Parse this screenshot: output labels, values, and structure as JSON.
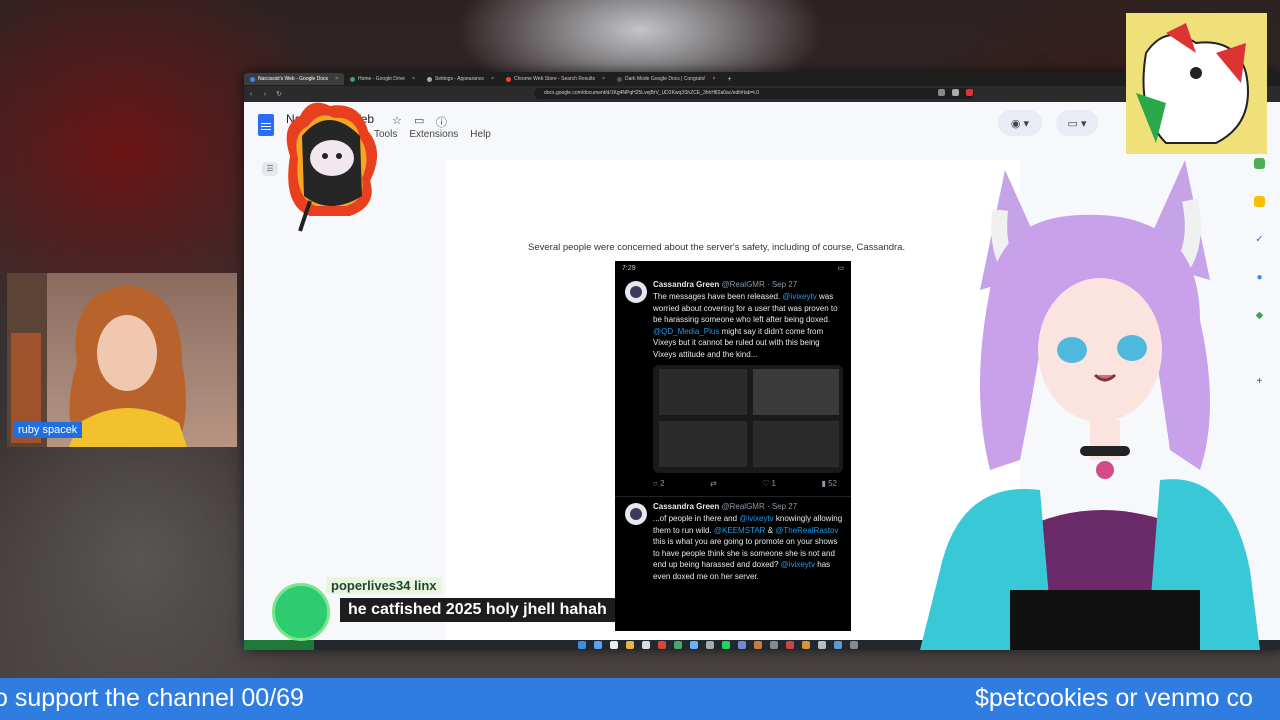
{
  "browser": {
    "tabs": [
      {
        "label": "Narcissist's Web - Google Docs",
        "active": true
      },
      {
        "label": "Home - Google Drive",
        "active": false
      },
      {
        "label": "Settings - Appearance",
        "active": false
      },
      {
        "label": "Chrome Web Store - Search Results",
        "active": false
      },
      {
        "label": "Dark Mode Google Docs | Congrats!",
        "active": false
      }
    ],
    "new_tab": "+",
    "url": "docs.google.com/document/d/1Kg4NPqH25LvejBrV_UD2Kwq3ShZCE_3hhH82a0ac/edit#tab=t.0"
  },
  "docs": {
    "title": "Narcissist's Web",
    "menu": [
      "Tools",
      "Extensions",
      "Help"
    ],
    "body_text": "Several people were concerned about the server's safety, including of course, Cassandra."
  },
  "tweets": {
    "status_time": "7:29",
    "items": [
      {
        "name": "Cassandra Green",
        "handle": "@RealGMR · Sep 27",
        "segments": [
          {
            "t": "The messages have been released. ",
            "m": false
          },
          {
            "t": "@ivixeytv",
            "m": true
          },
          {
            "t": " was worried about covering for a user that was proven to be harassing someone who left after being doxed. ",
            "m": false
          },
          {
            "t": "@QD_Media_Plus",
            "m": true
          },
          {
            "t": " might say it didn't come from Vixeys but it cannot be ruled out with this being Vixeys attitude and the kind...",
            "m": false
          }
        ],
        "actions": {
          "reply": "2",
          "retweet": "",
          "like": "1",
          "views": "52"
        }
      },
      {
        "name": "Cassandra Green",
        "handle": "@RealGMR · Sep 27",
        "segments": [
          {
            "t": "...of people in there and ",
            "m": false
          },
          {
            "t": "@ivixeytv",
            "m": true
          },
          {
            "t": " knowingly allowing them to run wild. ",
            "m": false
          },
          {
            "t": "@KEEMSTAR",
            "m": true
          },
          {
            "t": " & ",
            "m": false
          },
          {
            "t": "@TheRealRastov",
            "m": true
          },
          {
            "t": " this is what you are going to promote on your shows to have people think she is someone she is not and end up being harassed and doxed? ",
            "m": false
          },
          {
            "t": "@ivixeytv",
            "m": true
          },
          {
            "t": " has even doxed me on her server.",
            "m": false
          }
        ]
      }
    ]
  },
  "webcam": {
    "name": "ruby spacek"
  },
  "chat": {
    "username": "poperlives34 linx",
    "message": "he catfished 2025 holy jhell hahah"
  },
  "ticker": {
    "left_text": "o support the channel 00/69",
    "right_text": "$petcookies or venmo co"
  },
  "colors": {
    "ticker": "#2f7de0",
    "chat_user_bg": "#e8f6dd",
    "mention": "#1d9bf0",
    "docs_blue": "#2a6df4"
  }
}
